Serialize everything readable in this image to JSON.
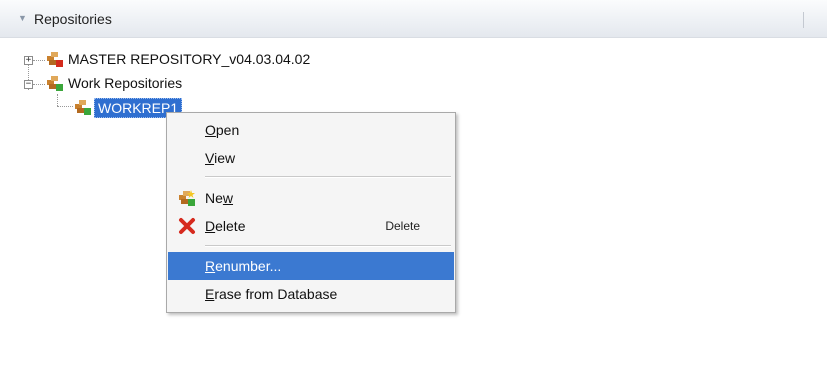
{
  "panel": {
    "title": "Repositories"
  },
  "tree": {
    "master": {
      "label": "MASTER REPOSITORY_v04.03.04.02",
      "expander": "+"
    },
    "work": {
      "label": "Work Repositories",
      "expander": "−"
    },
    "workrep": {
      "label": "WORKREP1"
    }
  },
  "context_menu": {
    "open": {
      "mn": "O",
      "rest": "pen"
    },
    "view": {
      "mn": "V",
      "rest": "iew"
    },
    "new": {
      "pre": "Ne",
      "mn": "w",
      "icon": "new-repository-icon"
    },
    "delete": {
      "mn": "D",
      "rest": "elete",
      "shortcut": "Delete",
      "icon": "red-x-delete-icon"
    },
    "renumber": {
      "mn": "R",
      "rest": "enumber..."
    },
    "erase": {
      "mn": "E",
      "rest": "rase from Database"
    }
  },
  "colors": {
    "selection": "#2f6fd0",
    "menu_highlight": "#3b79d1",
    "delete_icon": "#d62a1e",
    "repo_icon_base": "#c9812e"
  }
}
